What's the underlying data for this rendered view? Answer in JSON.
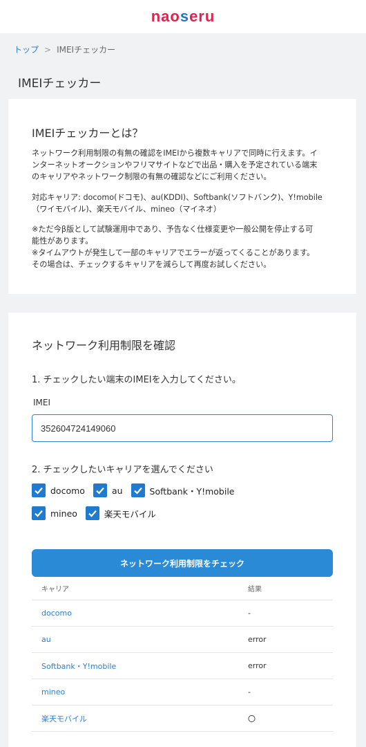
{
  "header": {
    "logo_part1": "nao",
    "logo_part2": "s",
    "logo_part3": "eru"
  },
  "breadcrumb": {
    "home": "トップ",
    "separator": ">",
    "current": "IMEIチェッカー"
  },
  "page_title": "IMEIチェッカー",
  "about": {
    "title": "IMEIチェッカーとは？",
    "p1_l1": "ネットワーク利用制限の有無の確認をIMEIから複数キャリアで同時に行えます。イ",
    "p1_l2": "ンターネットオークションやフリマサイトなどで出品・購入を予定されている端末",
    "p1_l3": "のキャリアやネットワーク制限の有無の確認などにご利用ください。",
    "p2_l1": "対応キャリア: docomo(ドコモ)、au(KDDI)、Softbank(ソフトバンク)、Y!mobile",
    "p2_l2": "（ワイモバイル)、楽天モバイル、mineo（マイネオ）",
    "p3_l1": "※ただ今β版として試験運用中であり、予告なく仕様変更や一般公開を停止する可",
    "p3_l2": "能性があります。",
    "p3_l3": "※タイムアウトが発生して一部のキャリアでエラーが返ってくることがあります。",
    "p3_l4": "その場合は、チェックするキャリアを減らして再度お試しください。"
  },
  "check": {
    "title": "ネットワーク利用制限を確認",
    "step1": "1. チェックしたい端末のIMEIを入力してください。",
    "imei_label": "IMEI",
    "imei_value": "352604724149060",
    "step2": "2. チェックしたいキャリアを選んでください",
    "carriers": [
      {
        "label": "docomo",
        "checked": true
      },
      {
        "label": "au",
        "checked": true
      },
      {
        "label": "Softbank・Y!mobile",
        "checked": true
      },
      {
        "label": "mineo",
        "checked": true
      },
      {
        "label": "楽天モバイル",
        "checked": true
      }
    ],
    "button_label": "ネットワーク利用制限をチェック"
  },
  "results": {
    "headers": [
      "キャリア",
      "結果"
    ],
    "rows": [
      {
        "carrier": "docomo",
        "result": "-"
      },
      {
        "carrier": "au",
        "result": "error"
      },
      {
        "carrier": "Softbank・Y!mobile",
        "result": "error"
      },
      {
        "carrier": "mineo",
        "result": "-"
      },
      {
        "carrier": "楽天モバイル",
        "result": "〇"
      }
    ]
  },
  "colors": {
    "accent": "#1e7bd0",
    "link": "#2a7fd4",
    "brand_red": "#e0234e",
    "background": "#f0f2f4"
  }
}
